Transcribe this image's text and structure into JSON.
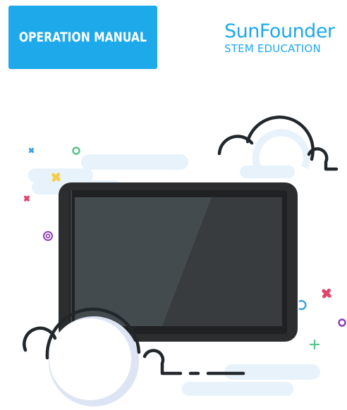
{
  "document": {
    "badge_label": "OPERATION MANUAL",
    "brand_name": "SunFounder",
    "brand_tagline": "STEM EDUCATION"
  },
  "colors": {
    "badge_bg": "#1ea9ea",
    "brand": "#1ea9ea",
    "cloud_shadow": "#e8f2fb",
    "device_frame": "#2b2d2f",
    "screen": "#3d4447"
  },
  "icons": [
    "cloud-icon",
    "sparkle-icon",
    "ring-icon",
    "plus-icon",
    "tablet-device-illustration"
  ]
}
